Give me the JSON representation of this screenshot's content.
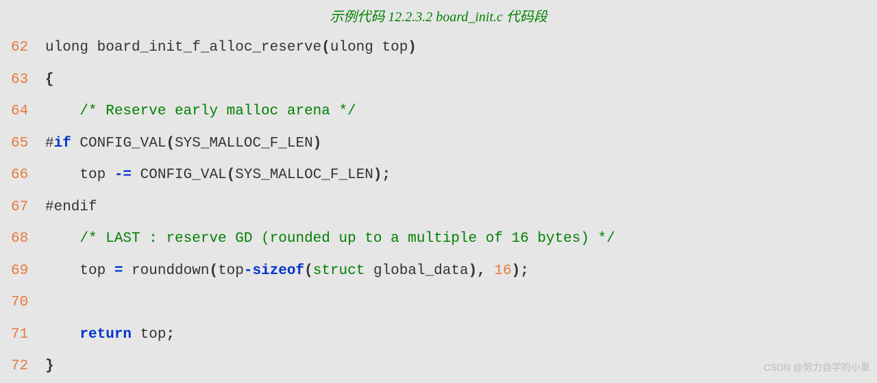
{
  "title": "示例代码 12.2.3.2 board_init.c 代码段",
  "watermark": "CSDN @努力自学的小夏",
  "lines": {
    "l62_num": "62",
    "l63_num": "63",
    "l64_num": "64",
    "l65_num": "65",
    "l66_num": "66",
    "l67_num": "67",
    "l68_num": "68",
    "l69_num": "69",
    "l70_num": "70",
    "l71_num": "71",
    "l72_num": "72"
  },
  "code": {
    "l62_a": "ulong board_init_f_alloc_reserve",
    "l62_b": "(",
    "l62_c": "ulong top",
    "l62_d": ")",
    "l63_a": "{",
    "l64_a": "    ",
    "l64_b": "/* Reserve early malloc arena */",
    "l65_a": "#",
    "l65_b": "if",
    "l65_c": " CONFIG_VAL",
    "l65_d": "(",
    "l65_e": "SYS_MALLOC_F_LEN",
    "l65_f": ")",
    "l66_a": "    top ",
    "l66_b": "-=",
    "l66_c": " CONFIG_VAL",
    "l66_d": "(",
    "l66_e": "SYS_MALLOC_F_LEN",
    "l66_f": ");",
    "l67_a": "#endif",
    "l68_a": "    ",
    "l68_b": "/* LAST : reserve GD (rounded up to a multiple of 16 bytes) */",
    "l69_a": "    top ",
    "l69_b": "=",
    "l69_c": " rounddown",
    "l69_d": "(",
    "l69_e": "top",
    "l69_f": "-",
    "l69_g": "sizeof",
    "l69_h": "(",
    "l69_i": "struct",
    "l69_j": " global_data",
    "l69_k": "),",
    "l69_l": " ",
    "l69_m": "16",
    "l69_n": ");",
    "l71_a": "    ",
    "l71_b": "return",
    "l71_c": " top",
    "l71_d": ";",
    "l72_a": "}"
  }
}
